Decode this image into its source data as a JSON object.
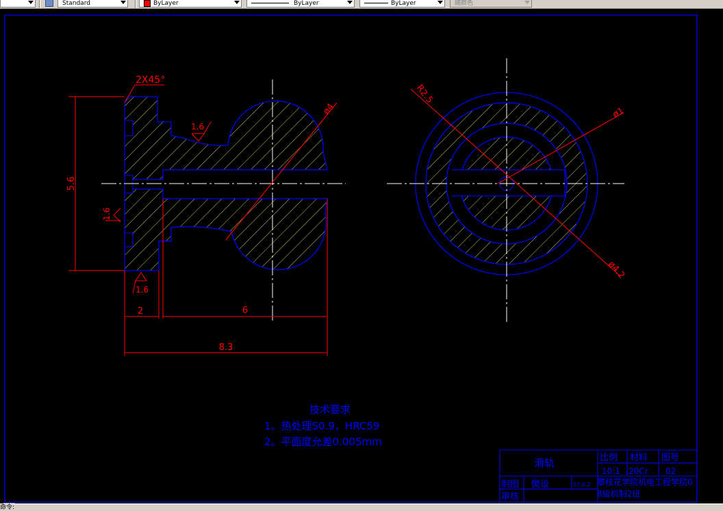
{
  "toolbar": {
    "text_style": "Standard",
    "layer": "ByLayer",
    "linetype": "ByLayer",
    "lineweight": "ByLayer",
    "plot_style": "随颜色"
  },
  "drawing": {
    "chamfer": "2X45°",
    "roughness": [
      "1.6",
      "1.6",
      "1.6"
    ],
    "dims": {
      "height": "5.6",
      "left_width": "2",
      "right_width": "6",
      "total_width": "8.3",
      "dia_ball": "ø4",
      "radius": "R2.5",
      "dia_inner": "ø1",
      "dia_outer": "ø4.2"
    },
    "tech": {
      "title": "技术要求",
      "line1": "1。热处理S0.9，HRC59",
      "line2": "2。平面度允差0.005mm"
    },
    "title_block": {
      "name": "滑轨",
      "scale_label": "比例",
      "material_label": "材料",
      "drawing_no_label": "图号",
      "scale": "10:1",
      "material": "20Cr",
      "drawing_no": "02",
      "drawn_label": "制图",
      "drawn_by": "樊设",
      "date": "07.6.2",
      "checked_label": "审核",
      "school": "攀枝花学院机电工程学院08级机制2班"
    }
  },
  "status": {
    "text": "命令:"
  },
  "colors": {
    "background": "#000000",
    "frame": "#0000ff",
    "section_outline": "#0000ff",
    "hatch": "#ffff80",
    "dimension": "#ff0000",
    "centerline": "#ffffff",
    "annotation": "#0000ff"
  }
}
